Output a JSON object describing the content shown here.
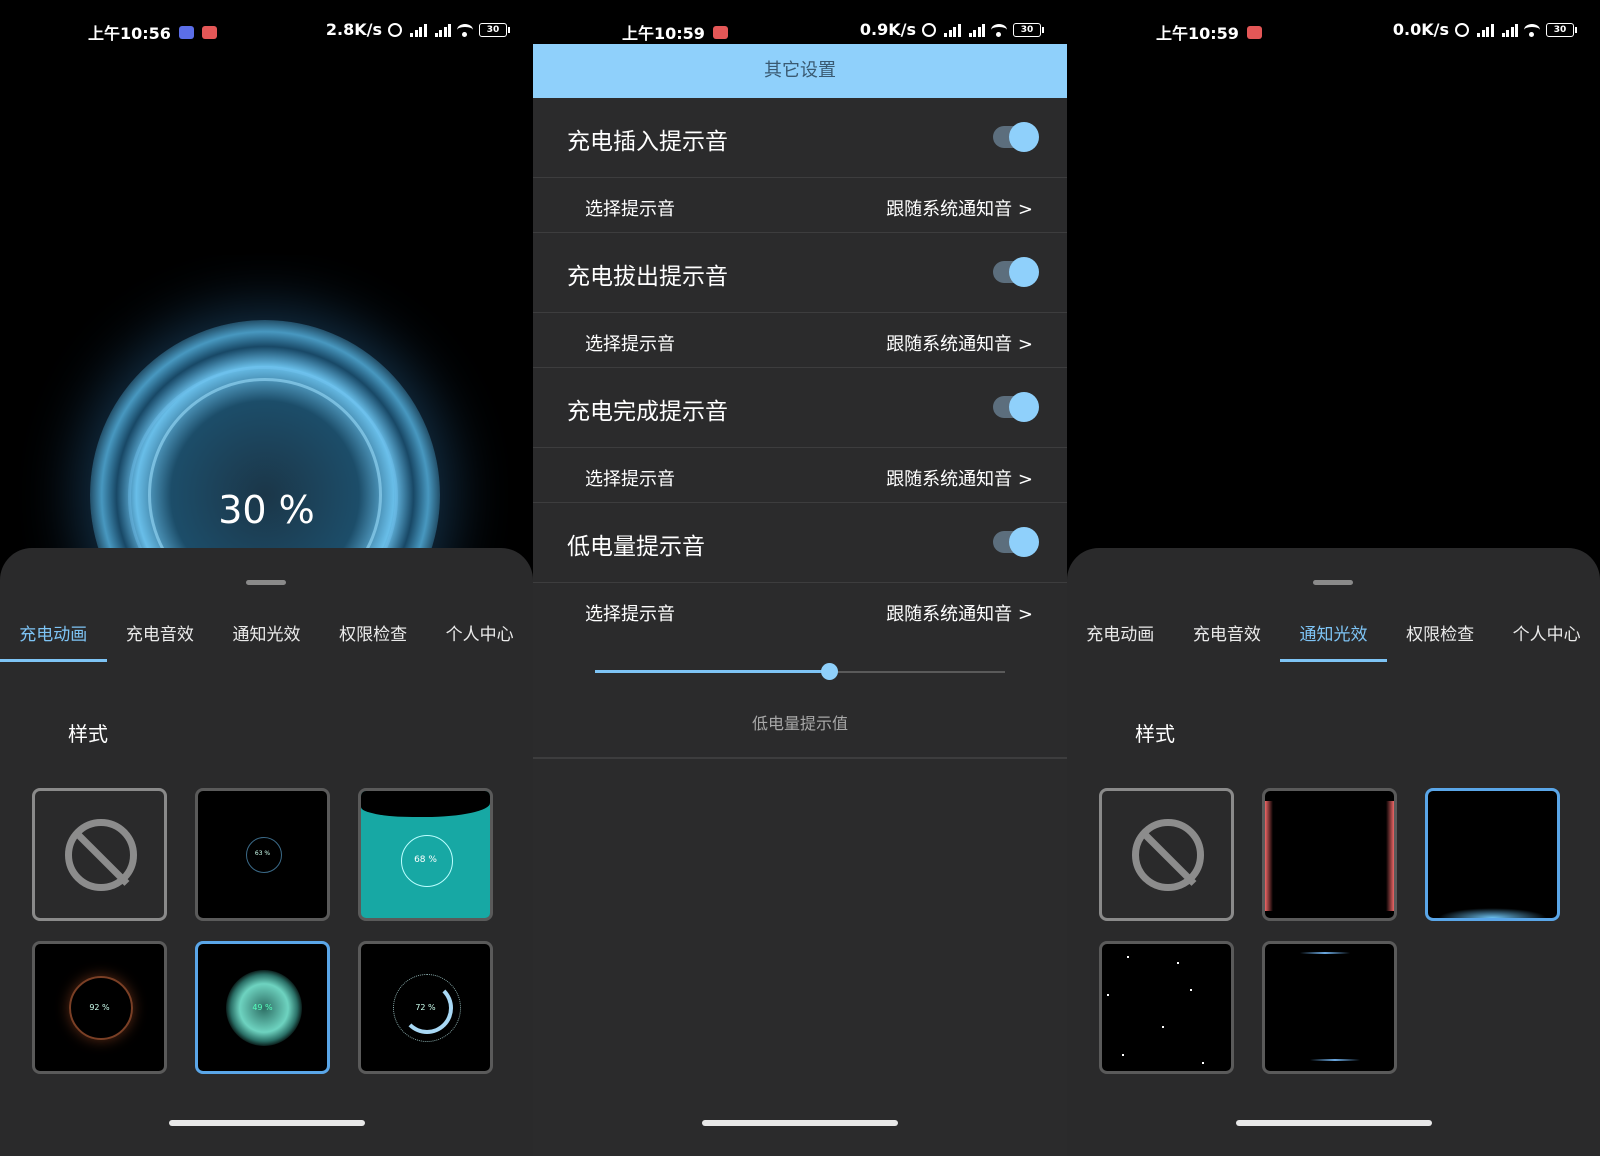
{
  "screen1": {
    "status": {
      "time": "上午10:56",
      "net": "2.8K/s",
      "battery": "30"
    },
    "percent": "30 %",
    "tabs": [
      "充电动画",
      "充电音效",
      "通知光效",
      "权限检查",
      "个人中心"
    ],
    "active_tab": 0,
    "section_label": "样式",
    "tiles": [
      "",
      "63 %",
      "68 %",
      "92 %",
      "49 %",
      "72 %"
    ],
    "selected_tile": 4
  },
  "screen2": {
    "status": {
      "time": "上午10:59",
      "net": "0.9K/s",
      "battery": "30"
    },
    "header": "其它设置",
    "sections": [
      {
        "title": "充电插入提示音",
        "enabled": true,
        "sub_label": "选择提示音",
        "sub_value": "跟随系统通知音 >"
      },
      {
        "title": "充电拔出提示音",
        "enabled": true,
        "sub_label": "选择提示音",
        "sub_value": "跟随系统通知音 >"
      },
      {
        "title": "充电完成提示音",
        "enabled": true,
        "sub_label": "选择提示音",
        "sub_value": "跟随系统通知音 >"
      },
      {
        "title": "低电量提示音",
        "enabled": true,
        "sub_label": "选择提示音",
        "sub_value": "跟随系统通知音 >"
      }
    ],
    "slider": {
      "label": "低电量提示值",
      "fraction": 0.57
    }
  },
  "screen3": {
    "status": {
      "time": "上午10:59",
      "net": "0.0K/s",
      "battery": "30"
    },
    "tabs": [
      "充电动画",
      "充电音效",
      "通知光效",
      "权限检查",
      "个人中心"
    ],
    "active_tab": 2,
    "section_label": "样式",
    "selected_tile": 2
  },
  "colors": {
    "accent": "#7ec4f5",
    "header_bg": "#8fd0fb",
    "panel_bg": "#2a2a2b",
    "toggle_track": "#5c6e7d"
  },
  "icons": [
    "message-icon",
    "record-icon",
    "alarm-icon",
    "signal-icon",
    "wifi-icon",
    "battery-icon",
    "no-effect-icon"
  ]
}
